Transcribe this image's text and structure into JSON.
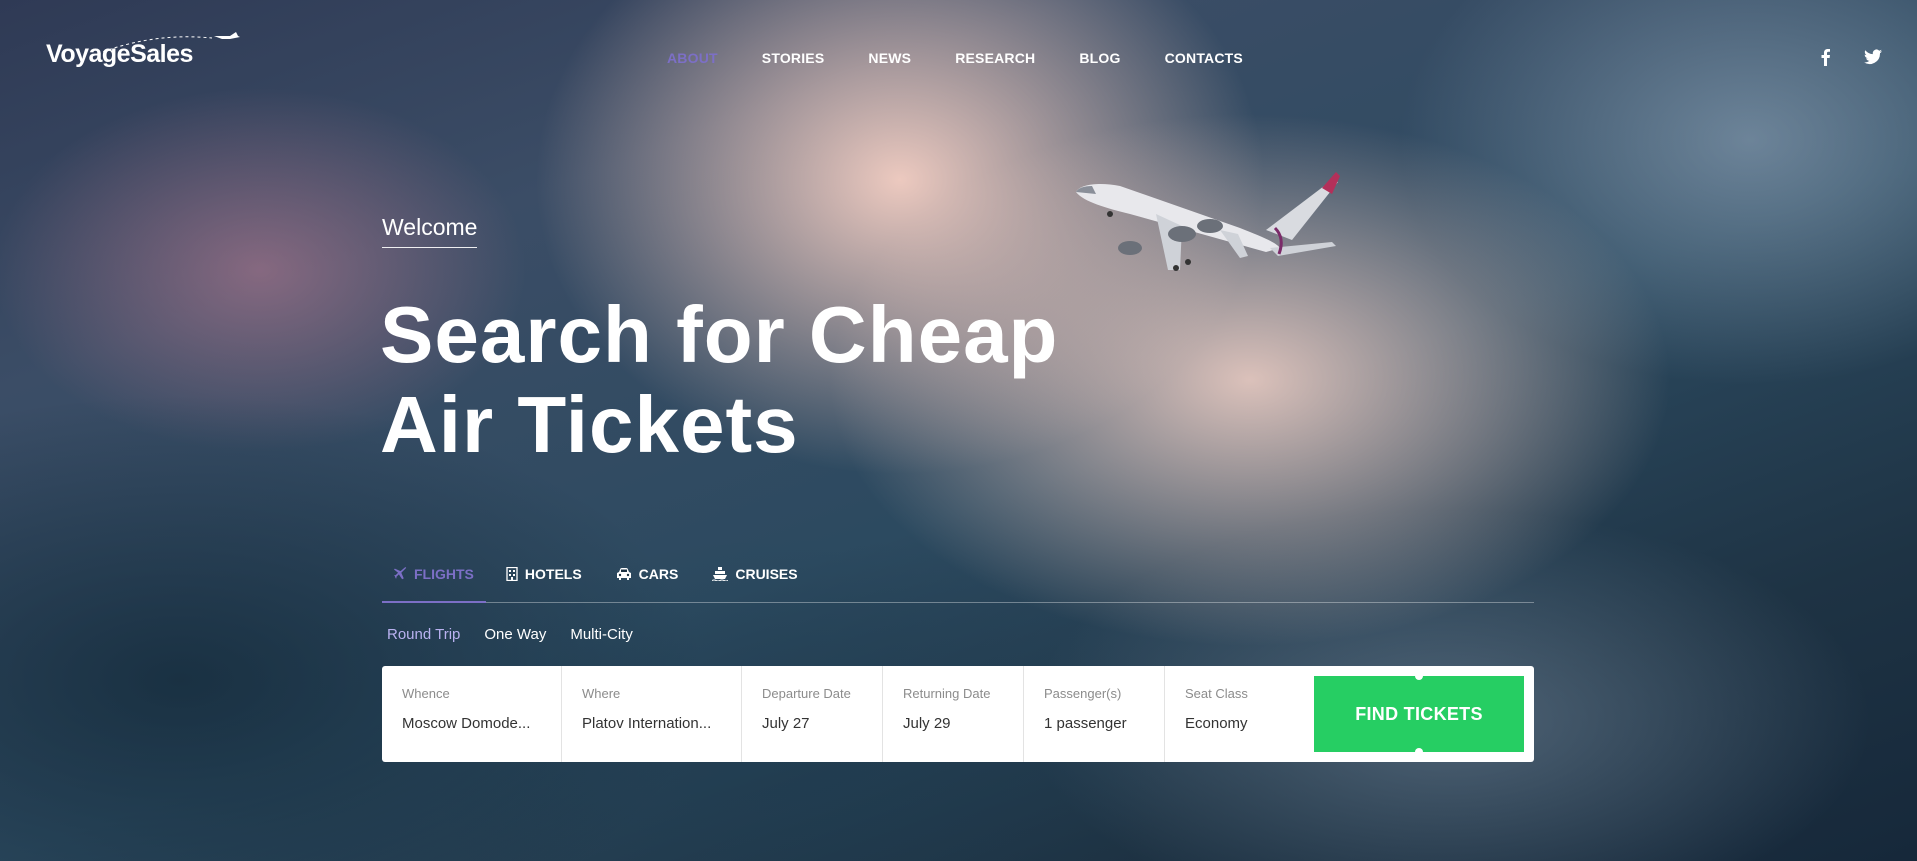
{
  "brand": {
    "name": "VoyageSales"
  },
  "nav": {
    "items": [
      {
        "label": "ABOUT",
        "active": true
      },
      {
        "label": "STORIES"
      },
      {
        "label": "NEWS"
      },
      {
        "label": "RESEARCH"
      },
      {
        "label": "BLOG"
      },
      {
        "label": "CONTACTS"
      }
    ]
  },
  "social": {
    "icons": [
      "facebook-icon",
      "twitter-icon"
    ]
  },
  "hero": {
    "welcome": "Welcome",
    "headline_line1": "Search for Cheap",
    "headline_line2": "Air Tickets"
  },
  "tabs": [
    {
      "label": "FLIGHTS",
      "icon": "airplane-icon",
      "active": true
    },
    {
      "label": "HOTELS",
      "icon": "building-icon"
    },
    {
      "label": "CARS",
      "icon": "car-icon"
    },
    {
      "label": "CRUISES",
      "icon": "ship-icon"
    }
  ],
  "trip_types": [
    {
      "label": "Round Trip",
      "active": true
    },
    {
      "label": "One Way"
    },
    {
      "label": "Multi-City"
    }
  ],
  "form": {
    "whence": {
      "label": "Whence",
      "value": "Moscow Domode..."
    },
    "where": {
      "label": "Where",
      "value": "Platov Internation..."
    },
    "departure": {
      "label": "Departure Date",
      "value": "July 27"
    },
    "returning": {
      "label": "Returning Date",
      "value": "July 29"
    },
    "passengers": {
      "label": "Passenger(s)",
      "value": "1 passenger"
    },
    "seat_class": {
      "label": "Seat Class",
      "value": "Economy"
    },
    "submit": "FIND TICKETS"
  },
  "colors": {
    "accent": "#7c6fc6",
    "button": "#26ce63",
    "text": "#ffffff"
  }
}
